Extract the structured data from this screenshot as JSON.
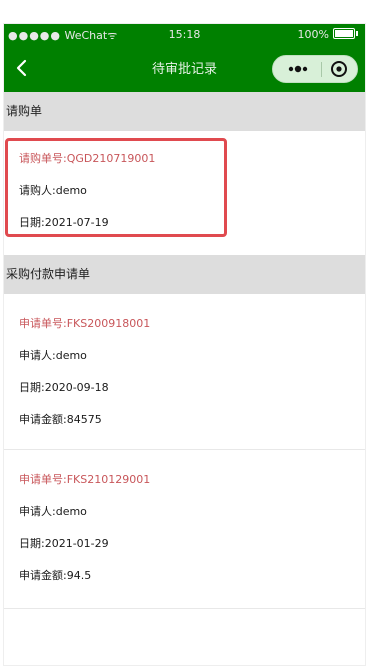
{
  "status_bar": {
    "carrier_dots": "●●●●●",
    "carrier": "WeChat",
    "wifi": "ᯤ",
    "time": "15:18",
    "battery": "100%"
  },
  "navbar": {
    "title": "待审批记录"
  },
  "sections": [
    {
      "title": "请购单",
      "items": [
        {
          "code_label": "请购单号:",
          "code": "QGD210719001",
          "person_label": "请购人:",
          "person": "demo",
          "date_label": "日期:",
          "date": "2021-07-19"
        }
      ]
    },
    {
      "title": "采购付款申请单",
      "items": [
        {
          "code_label": "申请单号:",
          "code": "FKS200918001",
          "person_label": "申请人:",
          "person": "demo",
          "date_label": "日期:",
          "date": "2020-09-18",
          "amount_label": "申请金额:",
          "amount": "84575"
        },
        {
          "code_label": "申请单号:",
          "code": "FKS210129001",
          "person_label": "申请人:",
          "person": "demo",
          "date_label": "日期:",
          "date": "2021-01-29",
          "amount_label": "申请金额:",
          "amount": "94.5"
        }
      ]
    }
  ],
  "colors": {
    "header_bg": "#008000",
    "section_bg": "#dddddd",
    "code_text": "#c8565a",
    "highlight_border": "#e04a4f"
  }
}
